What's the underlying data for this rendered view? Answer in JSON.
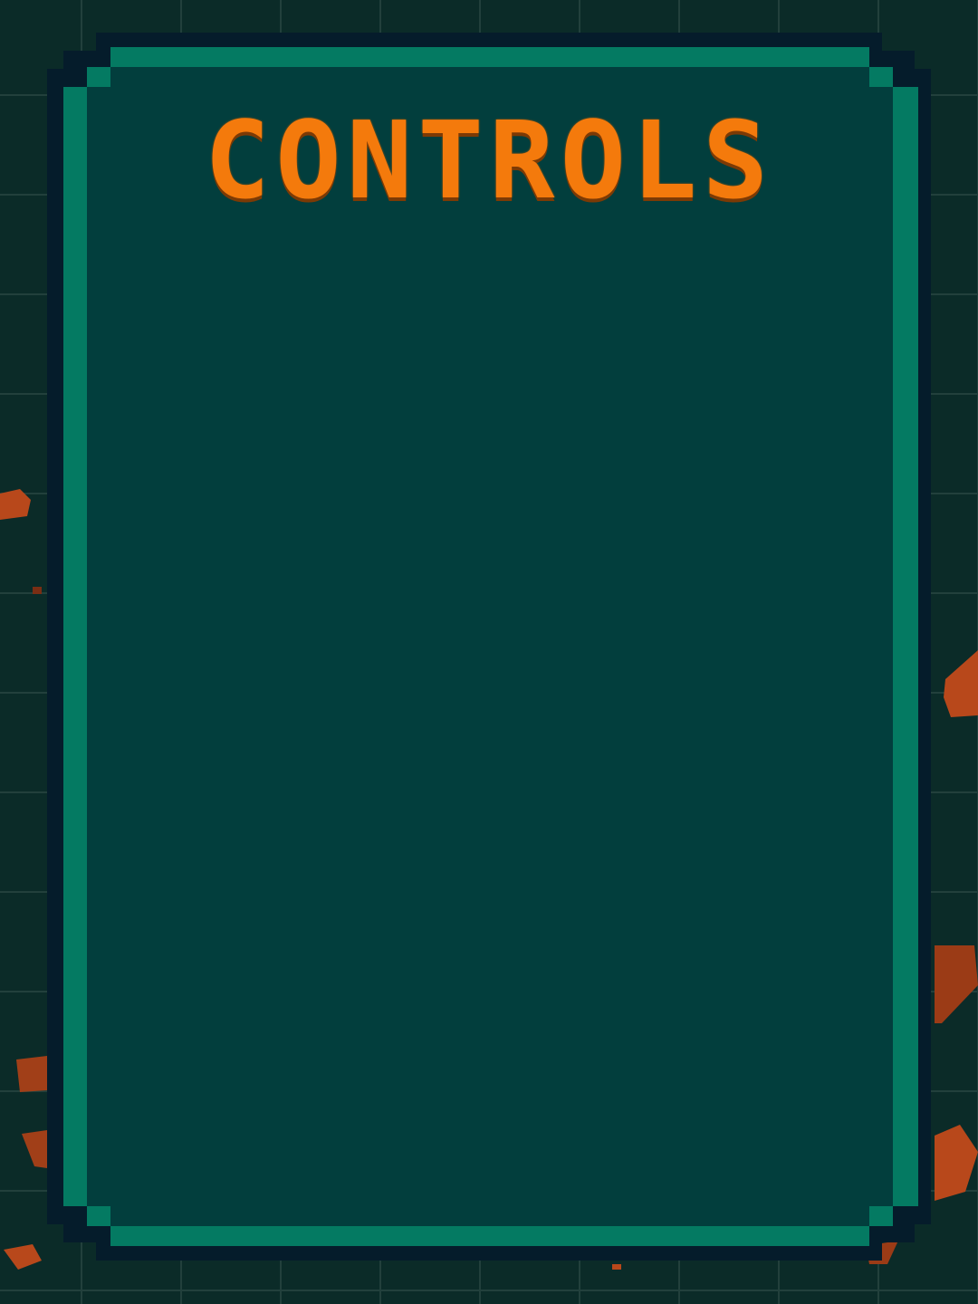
{
  "panel": {
    "title": "CONTROLS"
  },
  "colors": {
    "background": "#0b2b28",
    "grid_line": "#23403d",
    "frame_outline": "#051c2b",
    "frame_border": "#047a62",
    "panel_fill": "#023e3d",
    "title_text": "#f47a0c",
    "brick": "#b84a1c"
  }
}
